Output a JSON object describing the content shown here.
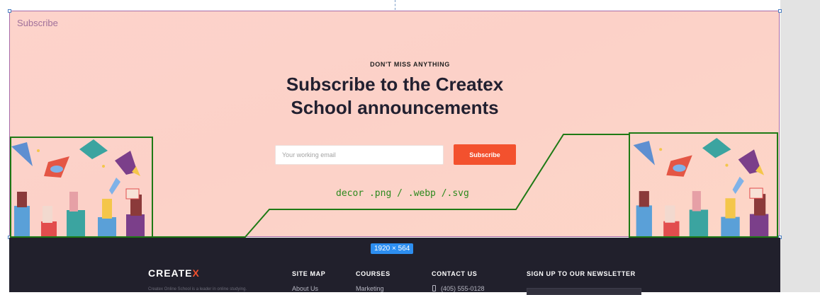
{
  "frame": {
    "label": "Subscribe"
  },
  "subscribe": {
    "eyebrow": "DON'T MISS ANYTHING",
    "headline": "Subscribe to the Createx School announcements",
    "email_placeholder": "Your working email",
    "button_label": "Subscribe"
  },
  "annotation": {
    "text": "decor .png / .webp /.svg"
  },
  "size_badge": "1920 × 564",
  "footer": {
    "logo_main": "CREATE",
    "logo_accent": "X",
    "blurb": "Createx Online School is a leader in online studying.",
    "columns": [
      {
        "title": "SITE MAP",
        "item": "About Us"
      },
      {
        "title": "COURSES",
        "item": "Marketing"
      },
      {
        "title": "CONTACT US",
        "item": "(405) 555-0128"
      },
      {
        "title": "SIGN UP TO OUR NEWSLETTER",
        "item": ""
      }
    ]
  },
  "colors": {
    "accent": "#f3512e",
    "section_bg": "#fdd3cb",
    "footer_bg": "#21202c",
    "annotation": "#1e7a15"
  }
}
